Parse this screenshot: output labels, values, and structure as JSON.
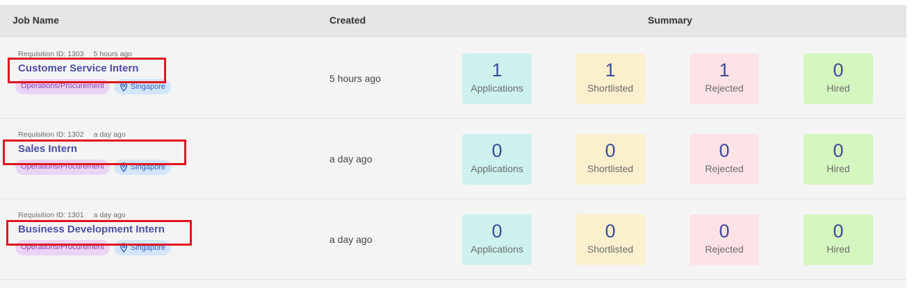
{
  "header": {
    "job_name": "Job Name",
    "created": "Created",
    "summary": "Summary"
  },
  "colors": {
    "title_link": "#4a4fa3",
    "highlight": "#e0141f",
    "applications_bg": "#cdf2ee",
    "shortlisted_bg": "#fbf0ce",
    "rejected_bg": "#fde3e6",
    "hired_bg": "#d4f6bf"
  },
  "rows": [
    {
      "requisition": "Requisition ID: 1303",
      "posted": "5 hours ago",
      "title": "Customer Service Intern",
      "department": "Operations/Procurement",
      "location": "Singapore",
      "created": "5 hours ago",
      "summary": {
        "applications": "1",
        "shortlisted": "1",
        "rejected": "1",
        "hired": "0"
      }
    },
    {
      "requisition": "Requisition ID: 1302",
      "posted": "a day ago",
      "title": "Sales Intern",
      "department": "Operations/Procurement",
      "location": "Singapore",
      "created": "a day ago",
      "summary": {
        "applications": "0",
        "shortlisted": "0",
        "rejected": "0",
        "hired": "0"
      }
    },
    {
      "requisition": "Requisition ID: 1301",
      "posted": "a day ago",
      "title": "Business Development Intern",
      "department": "Operations/Procurement",
      "location": "Singapore",
      "created": "a day ago",
      "summary": {
        "applications": "0",
        "shortlisted": "0",
        "rejected": "0",
        "hired": "0"
      }
    }
  ],
  "summary_labels": {
    "applications": "Applications",
    "shortlisted": "Shortlisted",
    "rejected": "Rejected",
    "hired": "Hired"
  },
  "icons": {
    "location": "map-pin-icon"
  }
}
